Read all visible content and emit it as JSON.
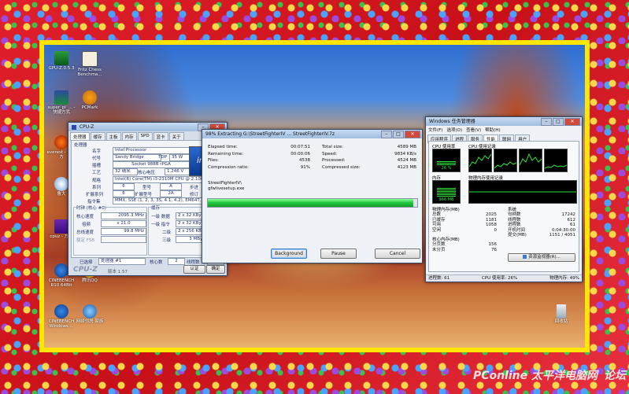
{
  "desktop_icons": [
    {
      "label": "GPU-Z.0.5.3",
      "icon": "gpuz-icon"
    },
    {
      "label": "Fritz Chess Benchma...",
      "icon": "chess-icon"
    },
    {
      "label": "super_pi_... - 快捷方式",
      "icon": "superpi-icon"
    },
    {
      "label": "PCMark",
      "icon": "pcmark-icon"
    },
    {
      "label": "everest - 快捷方",
      "icon": "everest-icon"
    },
    {
      "label": "鲁大",
      "icon": "ludashi-icon"
    },
    {
      "label": "cpuz - 方式",
      "icon": "cpuz-icon"
    },
    {
      "label": "CINEBENCH R10 64Bit",
      "icon": "cinebench-icon"
    },
    {
      "label": "腾讯QQ",
      "icon": "qq-icon"
    },
    {
      "label": "CINEBENCH Windows ...",
      "icon": "cinebench-icon"
    },
    {
      "label": "网络邻居 家族",
      "icon": "network-icon"
    },
    {
      "label": "回收站",
      "icon": "recycle-bin-icon"
    }
  ],
  "cpuz": {
    "title": "CPU-Z",
    "tabs": [
      "处理器",
      "缓存",
      "主板",
      "内存",
      "SPD",
      "显卡",
      "关于"
    ],
    "section_processor": "处理器",
    "name_label": "名字",
    "name_value": "Intel Processor",
    "code_label": "代号",
    "code_value": "Sandy Bridge",
    "tdp_label": "TDP",
    "tdp_value": "35 W",
    "package_label": "插槽",
    "package_value": "Socket 988B rPGA",
    "tech_label": "工艺",
    "tech_value": "32 纳米",
    "voltage_label": "核心电压",
    "voltage_value": "1.246 V",
    "spec_label": "规格",
    "spec_value": "Intel(R) Core(TM) i3-2310M CPU @ 2.10GHz",
    "family_label": "系列",
    "family_value": "6",
    "model_label": "型号",
    "model_value": "A",
    "stepping_label": "步进",
    "stepping_value": "7",
    "extfamily_label": "扩展系列",
    "extfamily_value": "6",
    "extmodel_label": "扩展型号",
    "extmodel_value": "2A",
    "revision_label": "修订",
    "revision_value": "D2",
    "instr_label": "指令集",
    "instr_value": "MMX, SSE (1, 2, 3, 3S, 4.1, 4.2), EM64T, VT-x, AVX",
    "clocks_title": "时钟 (核心 #0)",
    "core_speed_label": "核心速度",
    "core_speed_value": "2095.3 MHz",
    "multiplier_label": "倍频",
    "multiplier_value": "x 21.0",
    "bus_label": "总线速度",
    "bus_value": "99.8 MHz",
    "fsb_label": "额定 FSB",
    "cache_title": "缓存",
    "l1d_label": "一级 数据",
    "l1d_value": "2 x 32 KBytes",
    "l1i_label": "一级 指令",
    "l1i_value": "2 x 32 KBytes",
    "l2_label": "二级",
    "l2_value": "2 x 256 KBytes",
    "l3_label": "三级",
    "l3_value": "3 MBytes",
    "selected_label": "已选择",
    "selected_value": "处理器 #1",
    "cores_label": "核心数",
    "cores_value": "2",
    "threads_label": "线程数",
    "threads_value": "4",
    "footer_logo": "CPU-Z",
    "version": "版本 1.57",
    "ok_button": "认证",
    "confirm_button": "确定",
    "intel_logo": "intel"
  },
  "extract": {
    "title": "98% Extracting G:\\StreetFighterIV ... StreetFighterIV.7z",
    "elapsed_label": "Elapsed time:",
    "elapsed_value": "00:07:51",
    "remaining_label": "Remaining time:",
    "remaining_value": "00:00:06",
    "files_label": "Files:",
    "files_value": "4538",
    "ratio_label": "Compression ratio:",
    "ratio_value": "91%",
    "total_label": "Total size:",
    "total_value": "4589 MB",
    "speed_label": "Speed:",
    "speed_value": "9834 KB/s",
    "processed_label": "Processed:",
    "processed_value": "4524 MB",
    "compressed_label": "Compressed size:",
    "compressed_value": "4123 MB",
    "path_line1": "StreetFighterIV\\",
    "path_line2": "gfwlivesetup.exe",
    "progress": 0.98,
    "background_button": "Background",
    "pause_button": "Pause",
    "cancel_button": "Cancel"
  },
  "taskmgr": {
    "title": "Windows 任务管理器",
    "menu": [
      "文件(F)",
      "选项(O)",
      "查看(V)",
      "帮助(H)"
    ],
    "tabs": [
      "应用程序",
      "进程",
      "服务",
      "性能",
      "联网",
      "用户"
    ],
    "cpu_usage_label": "CPU 使用率",
    "cpu_usage_value": "26 %",
    "cpu_history_label": "CPU 使用记录",
    "mem_label": "内存",
    "mem_value": "966 MB",
    "mem_history_label": "物理内存使用记录",
    "physical_title": "物理内存(MB)",
    "total_label": "总数",
    "total_value": "2025",
    "cached_label": "已缓存",
    "cached_value": "1181",
    "available_label": "可用",
    "available_value": "1058",
    "free_label": "空闲",
    "free_value": "0",
    "system_title": "系统",
    "handles_label": "句柄数",
    "handles_value": "17242",
    "threads_label": "线程数",
    "threads_value": "612",
    "processes_label": "进程数",
    "processes_value": "61",
    "uptime_label": "开机时间",
    "uptime_value": "0:04:30:00",
    "commit_label": "提交(MB)",
    "commit_value": "1151 / 4051",
    "kernel_title": "核心内存(MB)",
    "paged_label": "分页数",
    "paged_value": "156",
    "nonpaged_label": "未分页",
    "nonpaged_value": "76",
    "resmon_button": "资源监视器(R)...",
    "status_processes": "进程数: 61",
    "status_cpu": "CPU 使用率: 26%",
    "status_mem": "物理内存: 49%"
  },
  "watermark": "PConline 太平洋电脑网",
  "watermark2": "论坛"
}
